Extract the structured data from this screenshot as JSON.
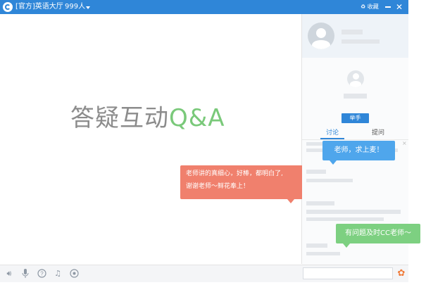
{
  "titlebar": {
    "title": "[官方]英语大厅",
    "count": "999人",
    "favorite": "♻ 收藏",
    "close": "✕"
  },
  "main": {
    "hero_text": "答疑互动",
    "hero_accent": "Q&A",
    "bubble_red_line1": "老师讲的真细心，好棒，都明白了,",
    "bubble_red_line2": "谢谢老师～鲜花奉上！"
  },
  "sidebar": {
    "assistant_label": "举手",
    "tabs": [
      "讨论",
      "提问"
    ],
    "bubble_blue": "老师，求上麦！",
    "bubble_green": "有问题及时CC老师～"
  },
  "bottombar": {
    "icons": [
      "speaker-icon",
      "microphone-icon",
      "question-icon",
      "music-icon",
      "record-icon",
      "flower-icon"
    ],
    "input_value": ""
  },
  "colors": {
    "titlebar": "#2f86d8",
    "accent_green": "#7ac97a",
    "bubble_red": "#f0806d",
    "bubble_blue": "#4fa6ec",
    "bubble_green": "#7dd081"
  }
}
